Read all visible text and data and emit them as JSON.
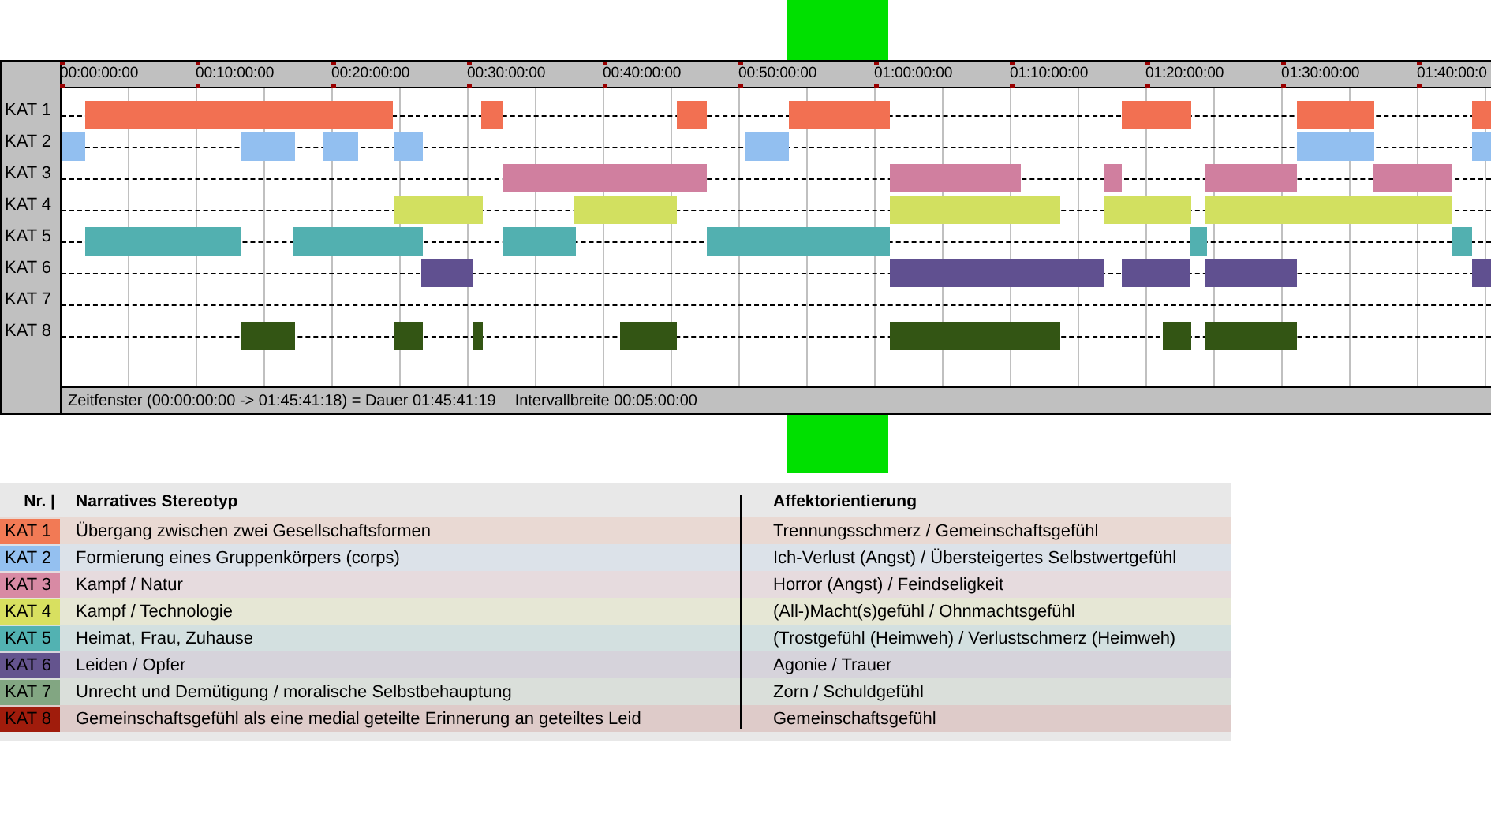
{
  "timeline": {
    "ruler": [
      "00:00:00:00",
      "00:10:00:00",
      "00:20:00:00",
      "00:30:00:00",
      "00:40:00:00",
      "00:50:00:00",
      "01:00:00:00",
      "01:10:00:00",
      "01:20:00:00",
      "01:30:00:00",
      "01:40:00:0"
    ],
    "rows": [
      {
        "label": "KAT 1",
        "color": "#f27052"
      },
      {
        "label": "KAT 2",
        "color": "#92bff0"
      },
      {
        "label": "KAT 3",
        "color": "#d07f9f"
      },
      {
        "label": "KAT 4",
        "color": "#d2e060"
      },
      {
        "label": "KAT 5",
        "color": "#52b0b0"
      },
      {
        "label": "KAT 6",
        "color": "#605090"
      },
      {
        "label": "KAT 7"
      },
      {
        "label": "KAT 8",
        "color": "#335514"
      }
    ],
    "status": "Zeitfenster (00:00:00:00 -> 01:45:41:18) = Dauer 01:45:41:19",
    "interval": "Intervallbreite 00:05:00:00"
  },
  "legend": {
    "columns": [
      "Nr. |",
      "Narratives Stereotyp",
      "Affektorientierung"
    ],
    "rows": [
      {
        "nr": "KAT 1",
        "color": "#f27a55",
        "stereotype": "Übergang zwischen zwei Gesellschaftsformen",
        "affect": "Trennungsschmerz / Gemeinschaftsgefühl"
      },
      {
        "nr": "KAT 2",
        "color": "#94c0f0",
        "stereotype": "Formierung eines Gruppenkörpers (corps)",
        "affect": "Ich-Verlust (Angst) / Übersteigertes Selbstwertgefühl"
      },
      {
        "nr": "KAT 3",
        "color": "#d88aa4",
        "stereotype": "Kampf / Natur",
        "affect": "Horror (Angst) / Feindseligkeit"
      },
      {
        "nr": "KAT 4",
        "color": "#d8e060",
        "stereotype": "Kampf / Technologie",
        "affect": "(All-)Macht(s)gefühl / Ohnmachtsgefühl"
      },
      {
        "nr": "KAT 5",
        "color": "#52b2b2",
        "stereotype": "Heimat, Frau, Zuhause",
        "affect": "(Trostgefühl (Heimweh) / Verlustschmerz (Heimweh)"
      },
      {
        "nr": "KAT 6",
        "color": "#64548e",
        "stereotype": "Leiden / Opfer",
        "affect": "Agonie / Trauer"
      },
      {
        "nr": "KAT 7",
        "color": "#82a682",
        "stereotype": "Unrecht und Demütigung / moralische Selbstbehauptung",
        "affect": "Zorn / Schuldgefühl"
      },
      {
        "nr": "KAT 8",
        "color": "#a01c0c",
        "stereotype": "Gemeinschaftsgefühl als eine medial geteilte Erinnerung an geteiltes Leid",
        "affect": "Gemeinschaftsgefühl"
      }
    ]
  }
}
